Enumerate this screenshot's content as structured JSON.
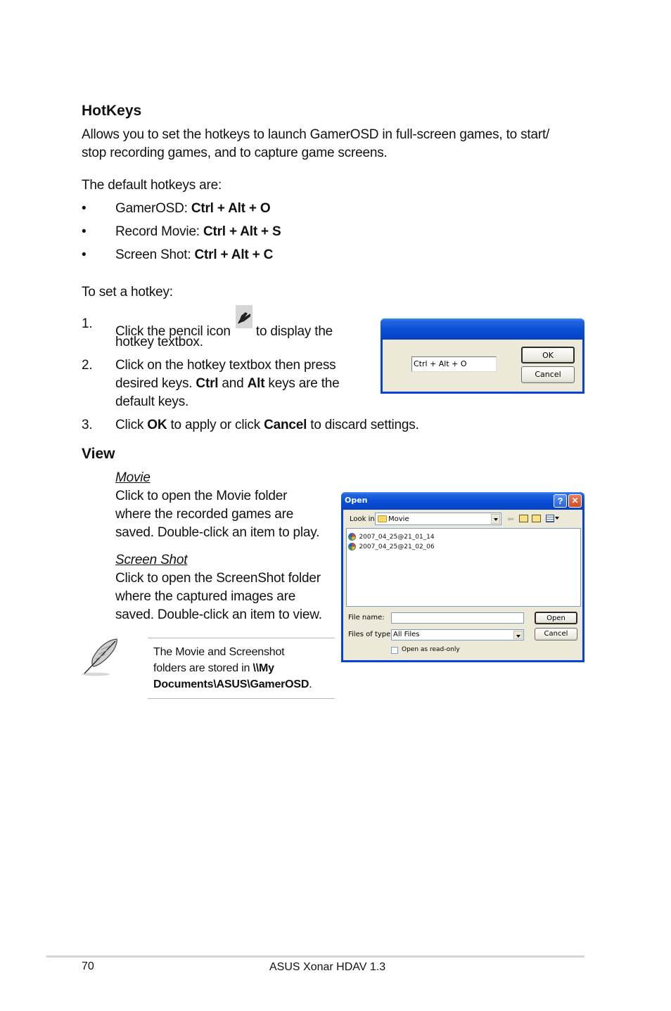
{
  "hotkeys": {
    "heading": "HotKeys",
    "intro_line1": "Allows you to set the hotkeys to launch GamerOSD in full-screen games, to start/",
    "intro_line2": "stop recording games, and to capture game screens.",
    "defaults_label": "The default hotkeys are:",
    "bullet_glyph": "•",
    "defaults": [
      {
        "label": "GamerOSD: ",
        "keys": "Ctrl + Alt + O"
      },
      {
        "label": "Record Movie: ",
        "keys": "Ctrl + Alt + S"
      },
      {
        "label": "Screen Shot: ",
        "keys": "Ctrl + Alt + C"
      }
    ],
    "set_label": "To set a hotkey:",
    "steps": [
      {
        "num": "1.",
        "a": "Click the pencil icon",
        "b": " to display the",
        "c": "hotkey textbox."
      },
      {
        "num": "2.",
        "a": "Click on the hotkey textbox then press",
        "b1": "desired keys. ",
        "b2": "Ctrl",
        "b3": " and ",
        "b4": "Alt",
        "b5": " keys are the",
        "c": "default keys."
      },
      {
        "num": "3.",
        "a": "Click ",
        "b": "OK",
        "c": " to apply or click ",
        "d": "Cancel",
        "e": " to discard settings."
      }
    ]
  },
  "hotkey_dialog": {
    "textbox_value": "Ctrl + Alt + O",
    "ok_label": "OK",
    "cancel_label": "Cancel"
  },
  "view": {
    "heading": "View",
    "movie_title": "Movie",
    "movie_lines": [
      "Click to open the Movie folder",
      "where the recorded games are",
      "saved. Double-click an item to play."
    ],
    "shot_title": "Screen Shot",
    "shot_lines": [
      "Click to open the ScreenShot folder",
      "where the captured images are",
      "saved. Double-click an item to view."
    ]
  },
  "open_dialog": {
    "title": "Open",
    "help_glyph": "?",
    "close_glyph": "✕",
    "look_in_label": "Look in:",
    "look_in_value": "Movie",
    "files": [
      "2007_04_25@21_01_14",
      "2007_04_25@21_02_06"
    ],
    "file_name_label": "File name:",
    "file_name_value": "",
    "files_of_type_label": "Files of type:",
    "files_of_type_value": "All Files",
    "open_label": "Open",
    "cancel_label": "Cancel",
    "readonly_label": "Open as read-only",
    "readonly_checked": false
  },
  "note": {
    "line1": "The Movie and Screenshot",
    "line2a": "folders are stored in ",
    "line2b": "\\\\My",
    "line3a": "Documents\\ASUS\\GamerOSD",
    "line3b": "."
  },
  "footer": {
    "page_number": "70",
    "title": "ASUS Xonar HDAV 1.3"
  },
  "colors": {
    "titlebar_blue": "#0a4fd8",
    "dialog_face": "#ece9d8",
    "close_red": "#e0502a"
  }
}
